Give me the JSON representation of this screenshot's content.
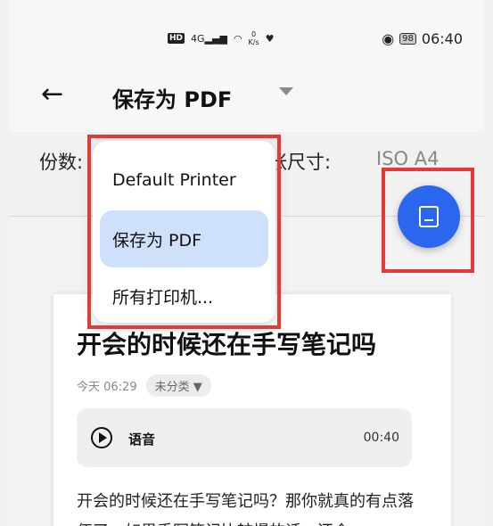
{
  "status_bar": {
    "hd": "HD",
    "network": "4G",
    "speed_value": "0",
    "speed_unit": "K/s",
    "battery": "98",
    "time": "06:40"
  },
  "app_bar": {
    "back_icon": "arrow-left-icon",
    "title": "保存为 PDF"
  },
  "options": {
    "copies_label": "份数:",
    "paper_size_label": "张尺寸:",
    "paper_size_value": "ISO A4"
  },
  "dropdown": {
    "items": [
      {
        "label": "Default Printer",
        "selected": false
      },
      {
        "label": "保存为 PDF",
        "selected": true
      },
      {
        "label": "所有打印机..."
      }
    ]
  },
  "fab": {
    "icon": "save-icon"
  },
  "preview": {
    "title": "开会的时候还在手写笔记吗",
    "date": "今天 06:29",
    "category": "未分类 ▼",
    "voice_label": "语音",
    "voice_duration": "00:40",
    "body": "开会的时候还在手写笔记吗？那你就真的有点落伍了，如果手写笔记比较慢的话，还会"
  },
  "colors": {
    "accent": "#2a66ee",
    "selected_bg": "#cfe0fb",
    "highlight": "#e53935"
  }
}
